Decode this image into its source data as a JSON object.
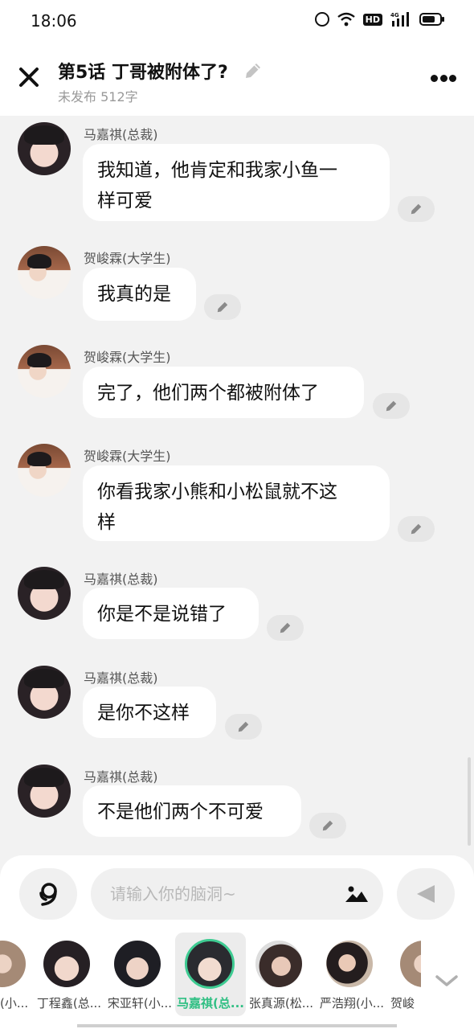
{
  "status_bar": {
    "time": "18:06",
    "hd": "HD",
    "network": "4G"
  },
  "header": {
    "title": "第5话  丁哥被附体了?",
    "subtitle": "未发布 512字"
  },
  "messages": [
    {
      "speaker": "马嘉祺(总裁)",
      "text_line1": "我知道，他肯定和我家小鱼一",
      "text_line2": "样可爱"
    },
    {
      "speaker": "贺峻霖(大学生)",
      "text_line1": "我真的是"
    },
    {
      "speaker": "贺峻霖(大学生)",
      "text_line1": "完了，他们两个都被附体了"
    },
    {
      "speaker": "贺峻霖(大学生)",
      "text_line1": "你看我家小熊和小松鼠就不这",
      "text_line2": "样"
    },
    {
      "speaker": "马嘉祺(总裁)",
      "text_line1": "你是不是说错了"
    },
    {
      "speaker": "马嘉祺(总裁)",
      "text_line1": "是你不这样"
    },
    {
      "speaker": "马嘉祺(总裁)",
      "text_line1": "不是他们两个不可爱"
    }
  ],
  "input": {
    "placeholder": "请输入你的脑洞~"
  },
  "roles": [
    {
      "name": "(小..."
    },
    {
      "name": "丁程鑫(总..."
    },
    {
      "name": "宋亚轩(小..."
    },
    {
      "name": "马嘉祺(总...",
      "selected": true
    },
    {
      "name": "张真源(松..."
    },
    {
      "name": "严浩翔(小..."
    },
    {
      "name": "贺峻"
    }
  ],
  "colors": {
    "accent": "#3ecb92",
    "bubble": "#ffffff",
    "background": "#f2f2f2"
  },
  "icons": {
    "close": "close-icon",
    "edit": "pencil-icon",
    "more": "more-dots-icon",
    "voice": "voice-icon",
    "image": "image-icon",
    "send": "send-icon",
    "expand": "chevron-down-icon"
  }
}
